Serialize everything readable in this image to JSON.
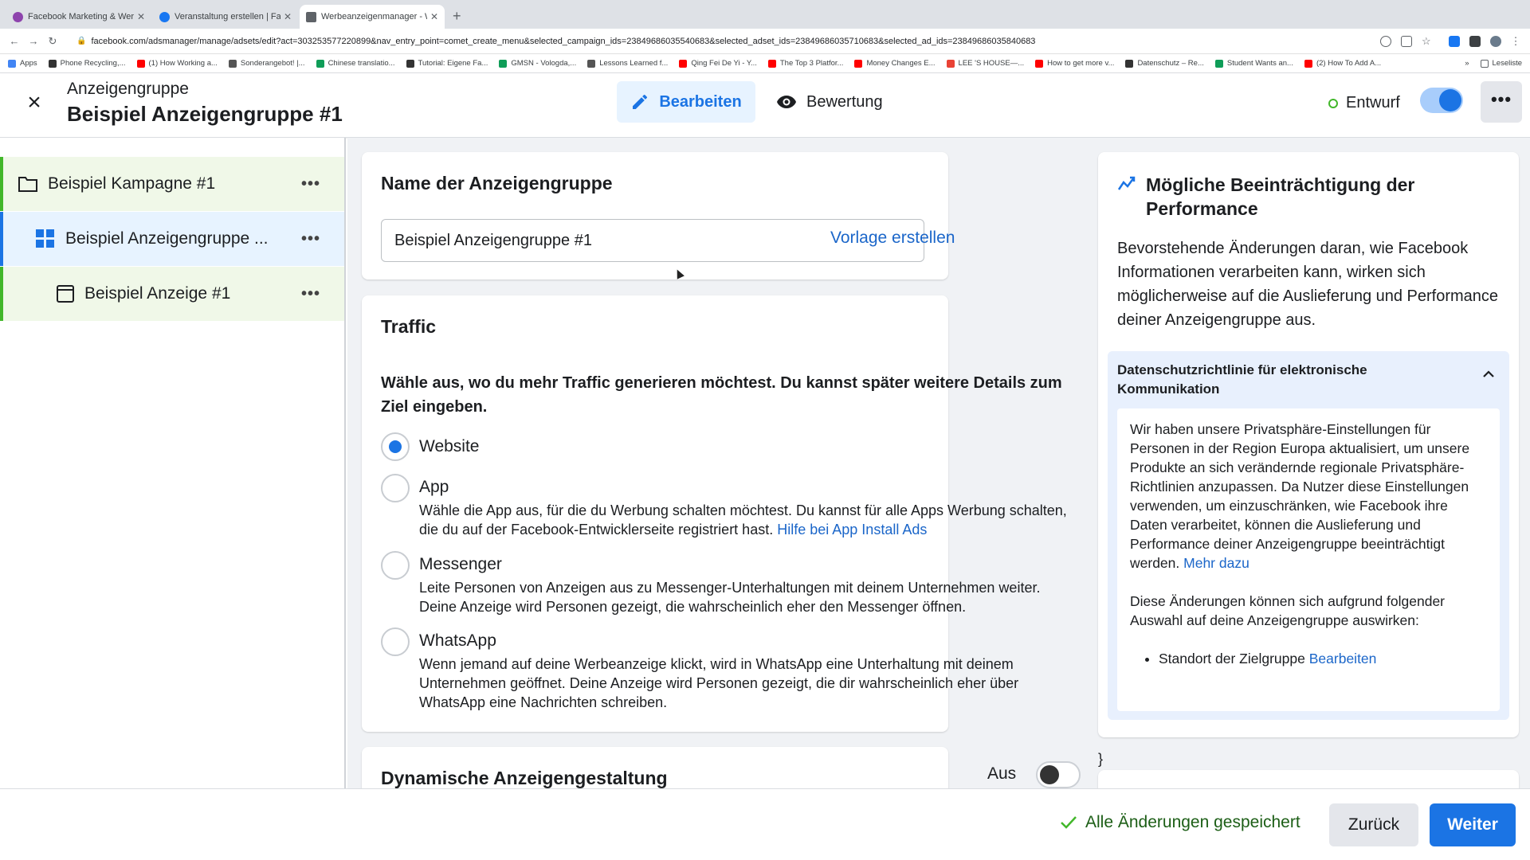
{
  "browser": {
    "tabs": [
      {
        "title": "Facebook Marketing & Werbe",
        "color": "#8e44ad"
      },
      {
        "title": "Veranstaltung erstellen | Faceb",
        "color": "#1877f2"
      },
      {
        "title": "Werbeanzeigenmanager - Wer",
        "color": "#5f6368"
      }
    ],
    "url": "facebook.com/adsmanager/manage/adsets/edit?act=303253577220899&nav_entry_point=comet_create_menu&selected_campaign_ids=23849686035540683&selected_adset_ids=23849686035710683&selected_ad_ids=23849686035840683",
    "bookmarks": [
      {
        "label": "Apps",
        "color": "#4285f4"
      },
      {
        "label": "Phone Recycling,...",
        "color": "#333333"
      },
      {
        "label": "(1) How Working a...",
        "color": "#ff0000"
      },
      {
        "label": "Sonderangebot! |...",
        "color": "#555555"
      },
      {
        "label": "Chinese translatio...",
        "color": "#0f9d58"
      },
      {
        "label": "Tutorial: Eigene Fa...",
        "color": "#333333"
      },
      {
        "label": "GMSN - Vologda,...",
        "color": "#0f9d58"
      },
      {
        "label": "Lessons Learned f...",
        "color": "#555555"
      },
      {
        "label": "Qing Fei De Yi - Y...",
        "color": "#ff0000"
      },
      {
        "label": "The Top 3 Platfor...",
        "color": "#ff0000"
      },
      {
        "label": "Money Changes E...",
        "color": "#ff0000"
      },
      {
        "label": "LEE 'S HOUSE—...",
        "color": "#e94235"
      },
      {
        "label": "How to get more v...",
        "color": "#ff0000"
      },
      {
        "label": "Datenschutz – Re...",
        "color": "#333333"
      },
      {
        "label": "Student Wants an...",
        "color": "#0f9d58"
      },
      {
        "label": "(2) How To Add A...",
        "color": "#ff0000"
      }
    ],
    "reading_list": "Leseliste"
  },
  "header": {
    "subtitle": "Anzeigengruppe",
    "title": "Beispiel Anzeigengruppe #1",
    "edit_label": "Bearbeiten",
    "review_label": "Bewertung",
    "status_label": "Entwurf"
  },
  "sidebar": {
    "items": [
      {
        "label": "Beispiel Kampagne #1"
      },
      {
        "label": "Beispiel Anzeigengruppe ..."
      },
      {
        "label": "Beispiel Anzeige #1"
      }
    ]
  },
  "name_card": {
    "title": "Name der Anzeigengruppe",
    "value": "Beispiel Anzeigengruppe #1",
    "template_link": "Vorlage erstellen"
  },
  "traffic_card": {
    "title": "Traffic",
    "question": "Wähle aus, wo du mehr Traffic generieren möchtest. Du kannst später weitere Details zum Ziel eingeben.",
    "options": [
      {
        "label": "Website",
        "selected": true
      },
      {
        "label": "App",
        "desc": "Wähle die App aus, für die du Werbung schalten möchtest. Du kannst für alle Apps Werbung schalten, die du auf der Facebook-Entwicklerseite registriert hast.",
        "link": "Hilfe bei App Install Ads"
      },
      {
        "label": "Messenger",
        "desc": "Leite Personen von Anzeigen aus zu Messenger-Unterhaltungen mit deinem Unternehmen weiter. Deine Anzeige wird Personen gezeigt, die wahrscheinlich eher den Messenger öffnen."
      },
      {
        "label": "WhatsApp",
        "desc": "Wenn jemand auf deine Werbeanzeige klickt, wird in WhatsApp eine Unterhaltung mit deinem Unternehmen geöffnet. Deine Anzeige wird Personen gezeigt, die dir wahrscheinlich eher über WhatsApp eine Nachrichten schreiben."
      }
    ]
  },
  "dynamic_card": {
    "title": "Dynamische Anzeigengestaltung",
    "toggle_label": "Aus"
  },
  "right_panel": {
    "title": "Mögliche Beeinträchtigung der Performance",
    "body": "Bevorstehende Änderungen daran, wie Facebook Informationen verarbeiten kann, wirken sich möglicherweise auf die Auslieferung und Performance deiner Anzeigengruppe aus.",
    "accordion_title": "Datenschutzrichtlinie für elektronische Kommunikation",
    "accordion_text": "Wir haben unsere Privatsphäre-Einstellungen für Personen in der Region Europa aktualisiert, um unsere Produkte an sich verändernde regionale Privatsphäre-Richtlinien anzupassen. Da Nutzer diese Einstellungen verwenden, um einzuschränken, wie Facebook ihre Daten verarbeitet, können die Auslieferung und Performance deiner Anzeigengruppe beeinträchtigt werden.",
    "more_link": "Mehr dazu",
    "accordion_text2": "Diese Änderungen können sich aufgrund folgender Auswahl auf deine Anzeigengruppe auswirken:",
    "bullet": "Standort der Zielgruppe",
    "bullet_link": "Bearbeiten",
    "stray": "}"
  },
  "footer": {
    "saved_label": "Alle Änderungen gespeichert",
    "back_label": "Zurück",
    "next_label": "Weiter"
  }
}
